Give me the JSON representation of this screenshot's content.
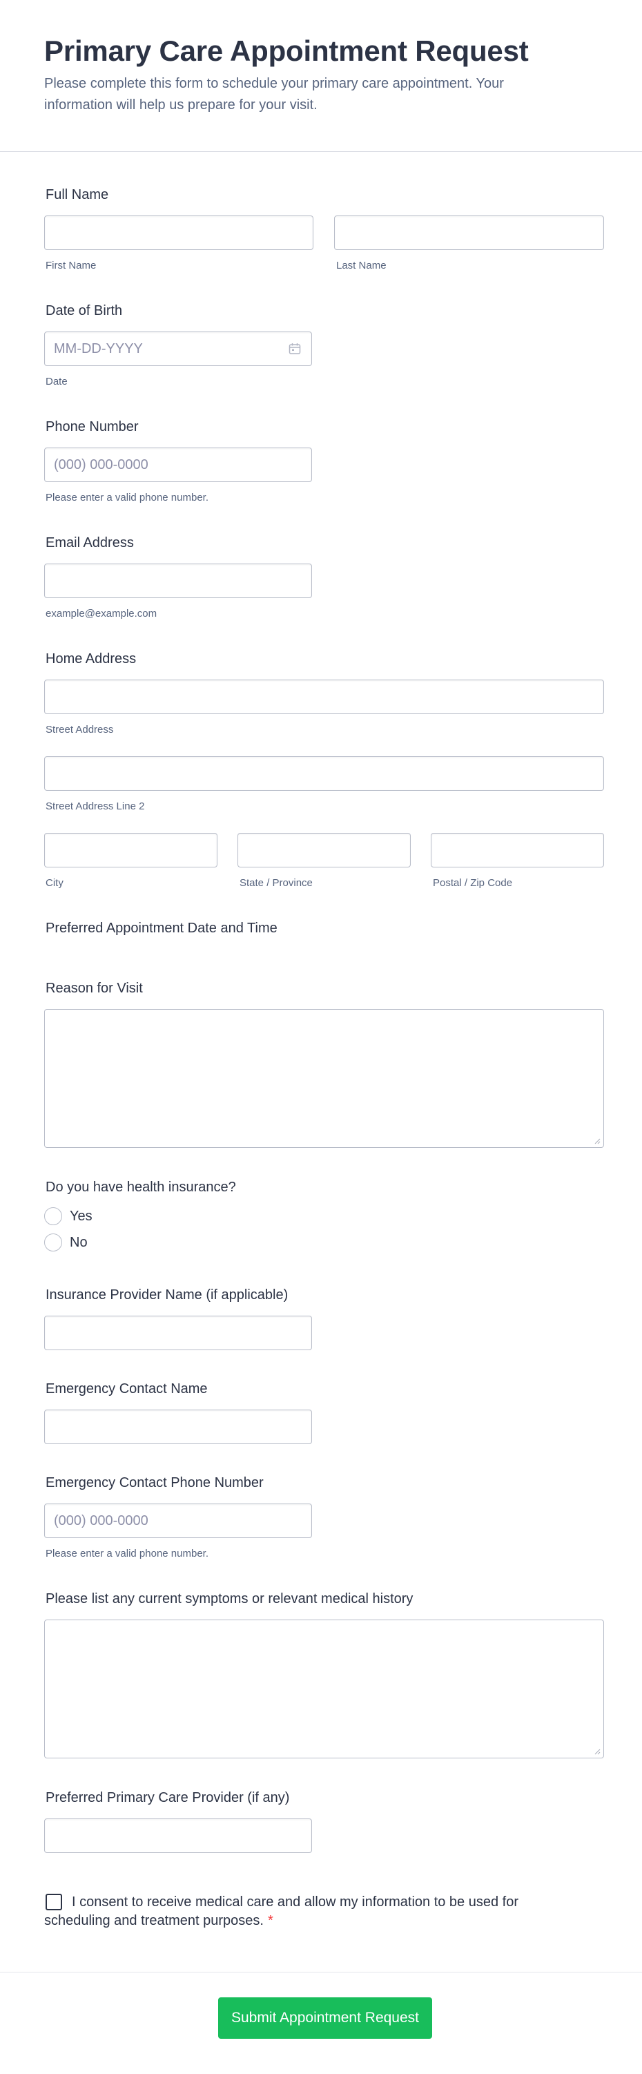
{
  "header": {
    "title": "Primary Care Appointment Request",
    "subtitle": "Please complete this form to schedule your primary care appointment. Your information will help us prepare for your visit."
  },
  "full_name": {
    "label": "Full Name",
    "first_sublabel": "First Name",
    "last_sublabel": "Last Name"
  },
  "dob": {
    "label": "Date of Birth",
    "placeholder": "MM-DD-YYYY",
    "sublabel": "Date",
    "icon": "calendar-icon"
  },
  "phone": {
    "label": "Phone Number",
    "placeholder": "(000) 000-0000",
    "sublabel": "Please enter a valid phone number."
  },
  "email": {
    "label": "Email Address",
    "sublabel": "example@example.com"
  },
  "address": {
    "label": "Home Address",
    "street": "Street Address",
    "street2": "Street Address Line 2",
    "city": "City",
    "state": "State / Province",
    "zip": "Postal / Zip Code"
  },
  "appointment": {
    "label": "Preferred Appointment Date and Time"
  },
  "reason": {
    "label": "Reason for Visit"
  },
  "insurance": {
    "label": "Do you have health insurance?",
    "options": [
      "Yes",
      "No"
    ]
  },
  "insurance_provider": {
    "label": "Insurance Provider Name (if applicable)"
  },
  "emergency_name": {
    "label": "Emergency Contact Name"
  },
  "emergency_phone": {
    "label": "Emergency Contact Phone Number",
    "placeholder": "(000) 000-0000",
    "sublabel": "Please enter a valid phone number."
  },
  "symptoms": {
    "label": "Please list any current symptoms or relevant medical history"
  },
  "provider": {
    "label": "Preferred Primary Care Provider (if any)"
  },
  "consent": {
    "text": "I consent to receive medical care and allow my information to be used for scheduling and treatment purposes.",
    "required_mark": "*"
  },
  "submit": {
    "label": "Submit Appointment Request",
    "color": "#18bd5b"
  }
}
